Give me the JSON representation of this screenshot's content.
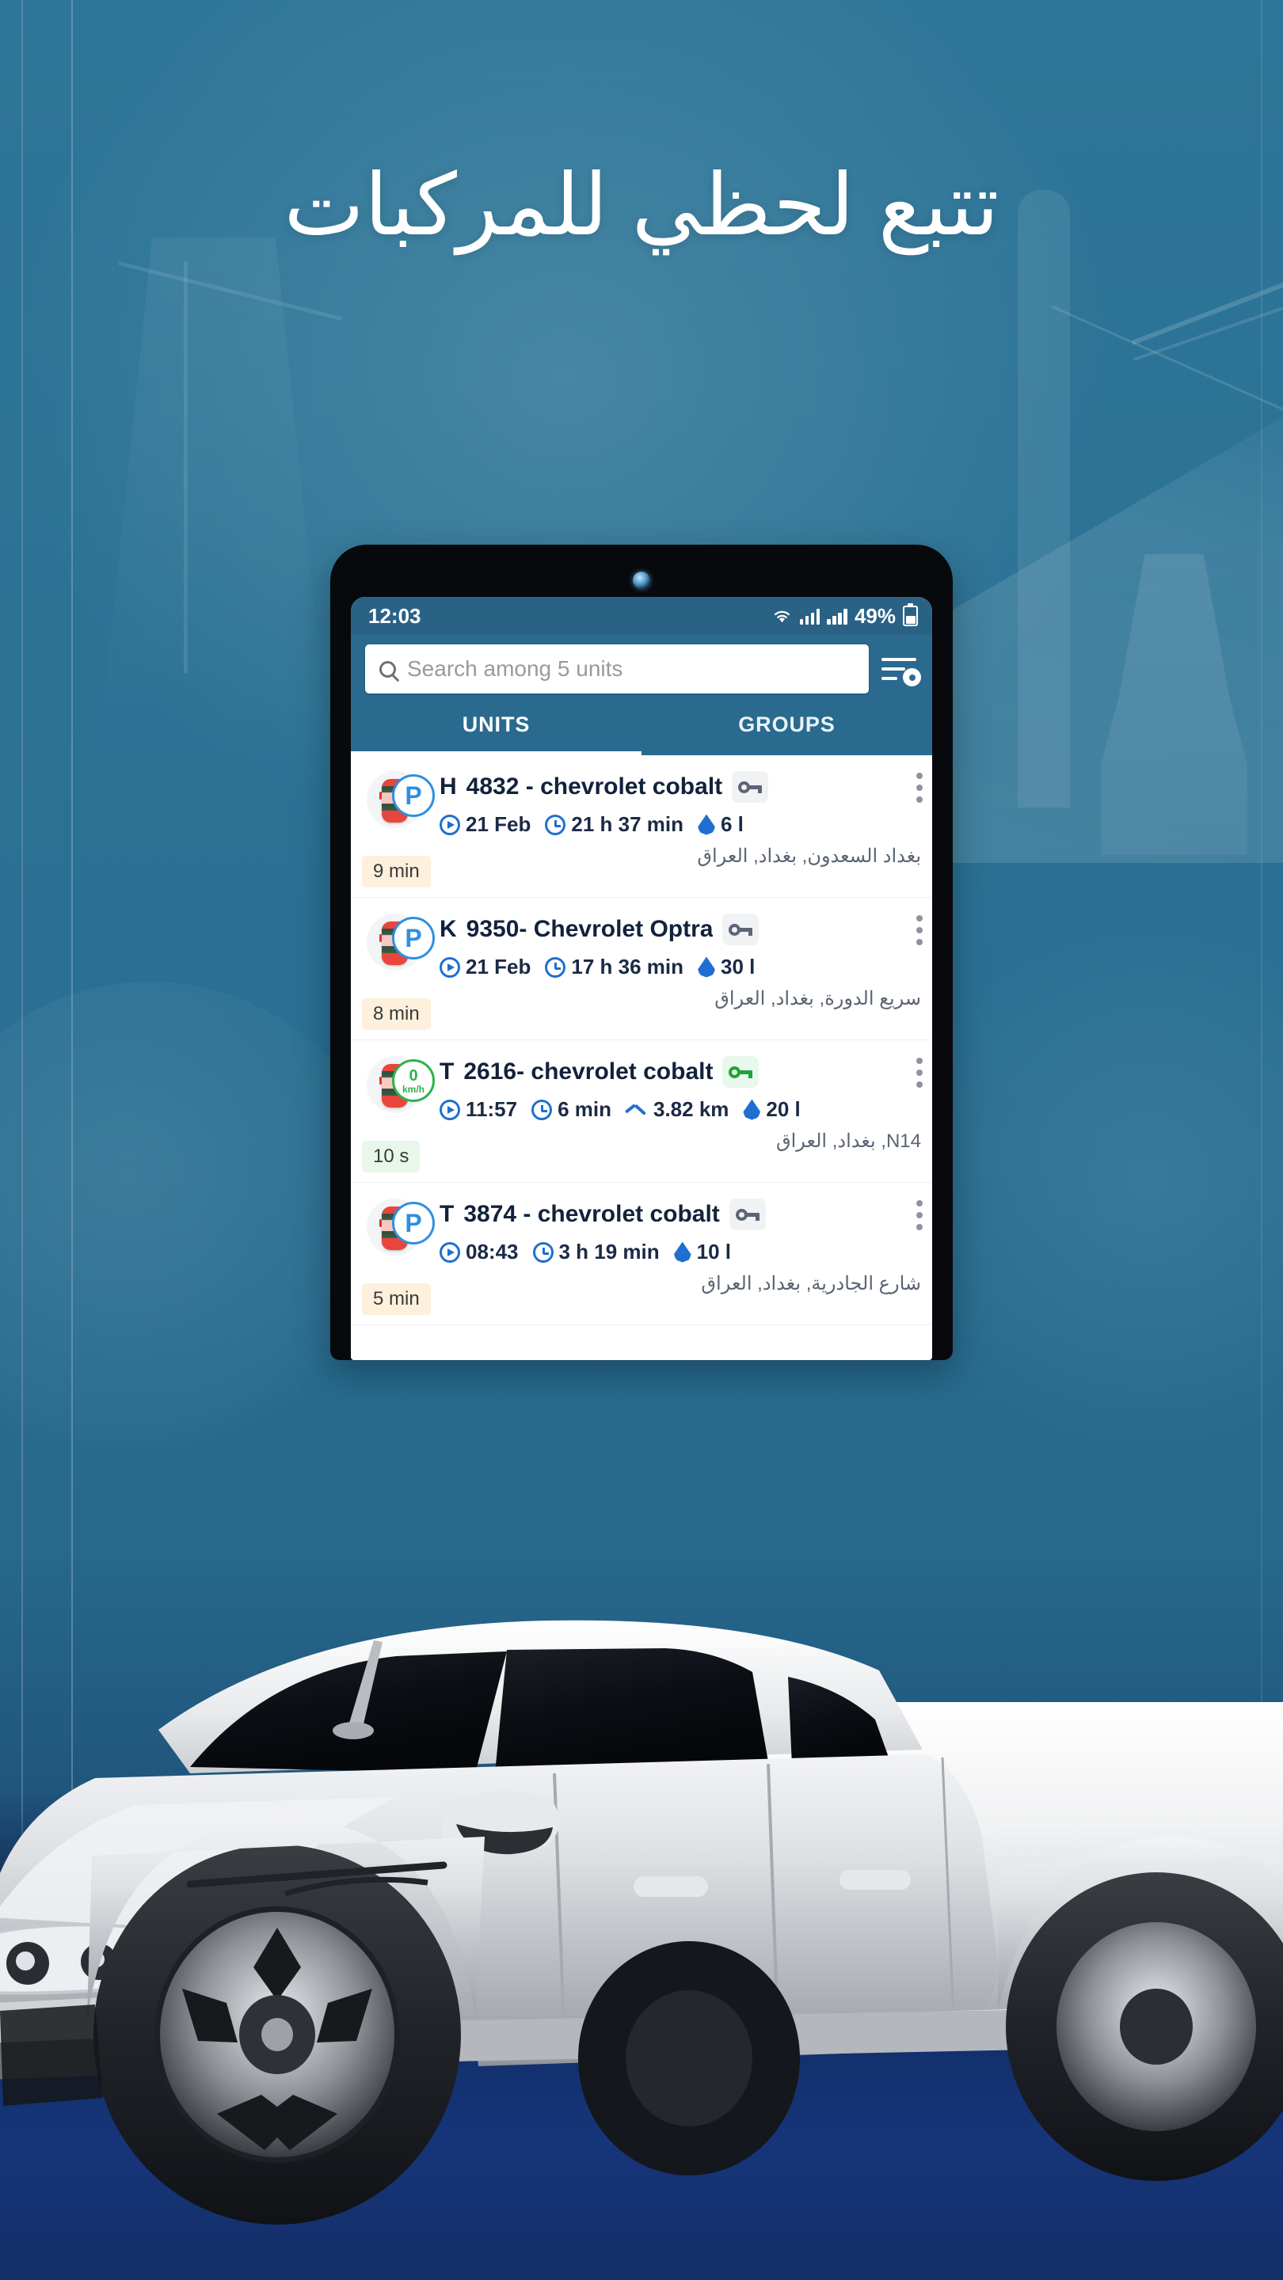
{
  "poster": {
    "headline_ar": "تتبع لحظي للمركبات",
    "background_color": "#2a7196",
    "ground_color": "#12306b",
    "accent_color": "#2a6a8f"
  },
  "phone": {
    "status_bar": {
      "time": "12:03",
      "battery_percent": "49%",
      "wifi_icon": "wifi-icon",
      "signal_icon_1": "signal-bars-icon",
      "signal_icon_2": "signal-bars-icon",
      "battery_icon": "battery-icon"
    },
    "app": {
      "search": {
        "placeholder": "Search among 5 units",
        "search_icon": "search-icon",
        "filter_icon": "sort-settings-icon"
      },
      "tabs": [
        {
          "label": "UNITS",
          "active": true
        },
        {
          "label": "GROUPS",
          "active": false
        }
      ],
      "units": [
        {
          "prefix": "H",
          "name": "4832 - chevrolet cobalt",
          "ignition": "off",
          "ignition_icon": "key-icon",
          "state": "parked",
          "state_badge": "P",
          "last_update": "21 Feb",
          "duration": "21 h 37 min",
          "fuel": "6 l",
          "distance": null,
          "address": "بغداد السعدون, بغداد, العراق",
          "time_badge": "9 min",
          "time_badge_color": "amber",
          "menu_icon": "more-vertical-icon",
          "vehicle_icon": "car-top-view-icon"
        },
        {
          "prefix": "K",
          "name": "9350- Chevrolet Optra",
          "ignition": "off",
          "ignition_icon": "key-icon",
          "state": "parked",
          "state_badge": "P",
          "last_update": "21 Feb",
          "duration": "17 h 36 min",
          "fuel": "30 l",
          "distance": null,
          "address": "سريع الدورة, بغداد, العراق",
          "time_badge": "8 min",
          "time_badge_color": "amber",
          "menu_icon": "more-vertical-icon",
          "vehicle_icon": "car-top-view-icon"
        },
        {
          "prefix": "T",
          "name": "2616- chevrolet cobalt",
          "ignition": "on",
          "ignition_icon": "key-icon",
          "state": "moving",
          "state_speed": "0",
          "state_speed_unit": "km/h",
          "last_update": "11:57",
          "duration": "6 min",
          "fuel": "20 l",
          "distance": "3.82 km",
          "address": "N14, بغداد, العراق",
          "time_badge": "10 s",
          "time_badge_color": "green",
          "menu_icon": "more-vertical-icon",
          "vehicle_icon": "car-top-view-icon"
        },
        {
          "prefix": "T",
          "name": "3874 - chevrolet cobalt",
          "ignition": "off",
          "ignition_icon": "key-icon",
          "state": "parked",
          "state_badge": "P",
          "last_update": "08:43",
          "duration": "3 h 19 min",
          "fuel": "10 l",
          "distance": null,
          "address": "شارع الجادرية, بغداد, العراق",
          "time_badge": "5 min",
          "time_badge_color": "amber",
          "menu_icon": "more-vertical-icon",
          "vehicle_icon": "car-top-view-icon"
        }
      ]
    }
  }
}
